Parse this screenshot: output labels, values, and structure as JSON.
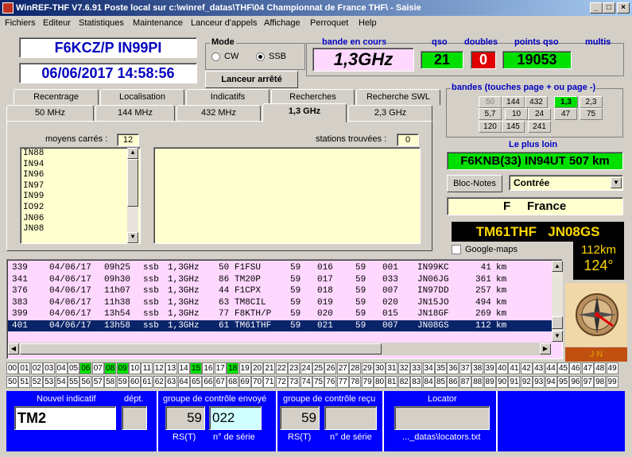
{
  "window": {
    "title": "WinREF-THF V7.6.91 Poste local sur c:\\winref_datas\\THF\\04 Championnat de France THF\\ -  Saisie",
    "buttons": [
      "_",
      "□",
      "×"
    ]
  },
  "menu": [
    "Fichiers",
    "Editeur",
    "Statistiques",
    "Maintenance",
    "Lanceur d'appels",
    "Affichage",
    "Perroquet",
    "Help"
  ],
  "station": {
    "call_loc": "F6KCZ/P  IN99PI",
    "date_time": "06/06/2017   14:58:56"
  },
  "mode": {
    "label": "Mode",
    "options": [
      "CW",
      "SSB"
    ],
    "selected": "SSB"
  },
  "launcher_button": "Lanceur arrêté",
  "header": {
    "band_label": "bande en cours",
    "band": "1,3GHz",
    "qso_label": "qso",
    "qso": "21",
    "doubles_label": "doubles",
    "doubles": "0",
    "points_label": "points qso",
    "points": "19053",
    "multis_label": "multis"
  },
  "tabs_row1": [
    "Recentrage",
    "Localisation",
    "Indicatifs",
    "Recherches",
    "Recherche SWL"
  ],
  "tabs_row2": [
    "50 MHz",
    "144 MHz",
    "432 MHz",
    "1,3 GHz",
    "2,3 GHz"
  ],
  "active_tab": "1,3 GHz",
  "panel": {
    "squares_label": "moyens carrés :",
    "squares_count": "12",
    "squares": [
      "IN88",
      "IN94",
      "IN96",
      "IN97",
      "IN99",
      "IO92",
      "JN06",
      "JN08"
    ],
    "stations_label": "stations trouvées :",
    "stations_count": "0"
  },
  "bands": {
    "label": "bandes (touches page + ou page -)",
    "items": [
      "50",
      "144",
      "432",
      "1,3",
      "2,3",
      "5,7",
      "10",
      "24",
      "47",
      "75",
      "120",
      "145",
      "241"
    ],
    "active": "1,3"
  },
  "farthest": {
    "label": "Le plus loin",
    "value": "F6KNB(33) IN94UT  507 km"
  },
  "notes_button": "Bloc-Notes",
  "country_select": "Contrée",
  "country": "F     France",
  "target": {
    "call": "TM61THF",
    "locator": "JN08GS",
    "distance": "112km",
    "azimuth": "124°",
    "google_label": "Google-maps",
    "compass_label": "J N"
  },
  "log_rows": [
    [
      "339",
      "04/06/17",
      "09h25",
      "ssb",
      "1,3GHz",
      "50",
      "F1FSU",
      "59",
      "016",
      "59",
      "001",
      "IN99KC",
      "41",
      "km"
    ],
    [
      "341",
      "04/06/17",
      "09h30",
      "ssb",
      "1,3GHz",
      "86",
      "TM20P",
      "59",
      "017",
      "59",
      "033",
      "JN06JG",
      "361",
      "km"
    ],
    [
      "376",
      "04/06/17",
      "11h07",
      "ssb",
      "1,3GHz",
      "44",
      "F1CPX",
      "59",
      "018",
      "59",
      "007",
      "IN97DD",
      "257",
      "km"
    ],
    [
      "383",
      "04/06/17",
      "11h38",
      "ssb",
      "1,3GHz",
      "63",
      "TM8CIL",
      "59",
      "019",
      "59",
      "020",
      "JN15JO",
      "494",
      "km"
    ],
    [
      "399",
      "04/06/17",
      "13h54",
      "ssb",
      "1,3GHz",
      "77",
      "F8KTH/P",
      "59",
      "020",
      "59",
      "015",
      "JN18GF",
      "269",
      "km"
    ],
    [
      "401",
      "04/06/17",
      "13h58",
      "ssb",
      "1,3GHz",
      "61",
      "TM61THF",
      "59",
      "021",
      "59",
      "007",
      "JN08GS",
      "112",
      "km"
    ]
  ],
  "selected_row": 5,
  "departments": {
    "green": [
      "06",
      "08",
      "09",
      "15",
      "18"
    ]
  },
  "entry": {
    "new_call_label": "Nouvel indicatif",
    "dept_label": "dépt.",
    "new_call": "TM2",
    "sent_label": "groupe de contrôle envoyé",
    "sent_rst": "59",
    "sent_serial": "022",
    "rcvd_label": "groupe de contrôle reçu",
    "rcvd_rst": "59",
    "rst_label": "RS(T)",
    "serial_label": "n° de série",
    "locator_label": "Locator",
    "locator_file": "..._datas\\locators.txt"
  },
  "colors": {
    "title_start": "#0a246a",
    "green_box": "#00e000",
    "red_box": "#e00000",
    "pink": "#ffd8ff",
    "yellow": "#ffffd0",
    "selected": "#0a246a",
    "blue_panel": "#0000ff"
  }
}
